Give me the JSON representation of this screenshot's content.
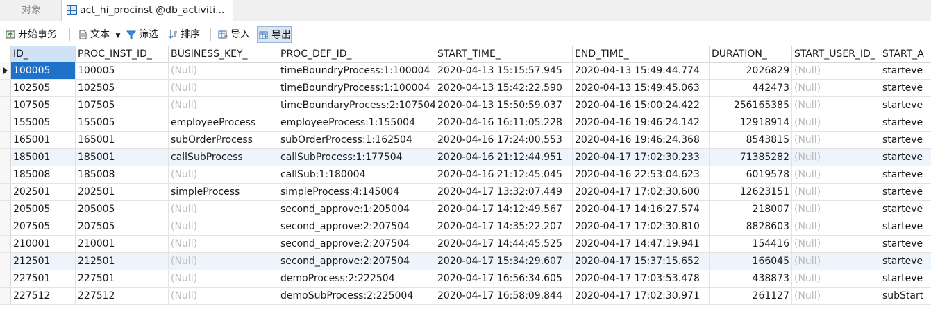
{
  "tabs": {
    "objects_label": "对象",
    "active_label": "act_hi_procinst @db_activiti..."
  },
  "toolbar": {
    "begin_tx": "开始事务",
    "text": "文本",
    "filter": "筛选",
    "sort": "排序",
    "import": "导入",
    "export": "导出"
  },
  "grid": {
    "columns": [
      "ID_",
      "PROC_INST_ID_",
      "BUSINESS_KEY_",
      "PROC_DEF_ID_",
      "START_TIME_",
      "END_TIME_",
      "DURATION_",
      "START_USER_ID_",
      "START_A"
    ],
    "rows": [
      [
        "100005",
        "100005",
        "(Null)",
        "timeBoundryProcess:1:100004",
        "2020-04-13 15:15:57.945",
        "2020-04-13 15:49:44.774",
        "2026829",
        "(Null)",
        "starteve"
      ],
      [
        "102505",
        "102505",
        "(Null)",
        "timeBoundryProcess:1:100004",
        "2020-04-13 15:42:22.590",
        "2020-04-13 15:49:45.063",
        "442473",
        "(Null)",
        "starteve"
      ],
      [
        "107505",
        "107505",
        "(Null)",
        "timeBoundaryProcess:2:107504",
        "2020-04-13 15:50:59.037",
        "2020-04-16 15:00:24.422",
        "256165385",
        "(Null)",
        "starteve"
      ],
      [
        "155005",
        "155005",
        "employeeProcess",
        "employeeProcess:1:155004",
        "2020-04-16 16:11:05.228",
        "2020-04-16 19:46:24.142",
        "12918914",
        "(Null)",
        "starteve"
      ],
      [
        "165001",
        "165001",
        "subOrderProcess",
        "subOrderProcess:1:162504",
        "2020-04-16 17:24:00.553",
        "2020-04-16 19:46:24.368",
        "8543815",
        "(Null)",
        "starteve"
      ],
      [
        "185001",
        "185001",
        "callSubProcess",
        "callSubProcess:1:177504",
        "2020-04-16 21:12:44.951",
        "2020-04-17 17:02:30.233",
        "71385282",
        "(Null)",
        "starteve"
      ],
      [
        "185008",
        "185008",
        "(Null)",
        "callSub:1:180004",
        "2020-04-16 21:12:45.045",
        "2020-04-16 22:53:04.623",
        "6019578",
        "(Null)",
        "starteve"
      ],
      [
        "202501",
        "202501",
        "simpleProcess",
        "simpleProcess:4:145004",
        "2020-04-17 13:32:07.449",
        "2020-04-17 17:02:30.600",
        "12623151",
        "(Null)",
        "starteve"
      ],
      [
        "205005",
        "205005",
        "(Null)",
        "second_approve:1:205004",
        "2020-04-17 14:12:49.567",
        "2020-04-17 14:16:27.574",
        "218007",
        "(Null)",
        "starteve"
      ],
      [
        "207505",
        "207505",
        "(Null)",
        "second_approve:2:207504",
        "2020-04-17 14:35:22.207",
        "2020-04-17 17:02:30.810",
        "8828603",
        "(Null)",
        "starteve"
      ],
      [
        "210001",
        "210001",
        "(Null)",
        "second_approve:2:207504",
        "2020-04-17 14:44:45.525",
        "2020-04-17 14:47:19.941",
        "154416",
        "(Null)",
        "starteve"
      ],
      [
        "212501",
        "212501",
        "(Null)",
        "second_approve:2:207504",
        "2020-04-17 15:34:29.607",
        "2020-04-17 15:37:15.652",
        "166045",
        "(Null)",
        "starteve"
      ],
      [
        "227501",
        "227501",
        "(Null)",
        "demoProcess:2:222504",
        "2020-04-17 16:56:34.605",
        "2020-04-17 17:03:53.478",
        "438873",
        "(Null)",
        "starteve"
      ],
      [
        "227512",
        "227512",
        "(Null)",
        "demoSubProcess:2:225004",
        "2020-04-17 16:58:09.844",
        "2020-04-17 17:02:30.971",
        "261127",
        "(Null)",
        "subStart"
      ]
    ]
  },
  "colors": {
    "selected_cell": "#1f72c9",
    "null_text": "#b9b9b9",
    "alt_row": "#eef4fb"
  }
}
